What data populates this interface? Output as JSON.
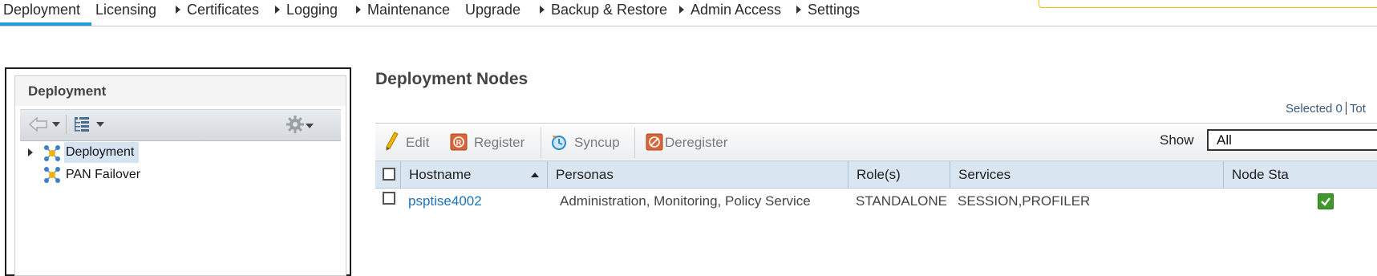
{
  "topnav": {
    "items": [
      {
        "label": "Deployment",
        "has_caret": false,
        "active": true
      },
      {
        "label": "Licensing",
        "has_caret": false,
        "active": false
      },
      {
        "label": "Certificates",
        "has_caret": true,
        "active": false
      },
      {
        "label": "Logging",
        "has_caret": true,
        "active": false
      },
      {
        "label": "Maintenance",
        "has_caret": true,
        "active": false
      },
      {
        "label": "Upgrade",
        "has_caret": false,
        "active": false
      },
      {
        "label": "Backup & Restore",
        "has_caret": true,
        "active": false
      },
      {
        "label": "Admin Access",
        "has_caret": true,
        "active": false
      },
      {
        "label": "Settings",
        "has_caret": true,
        "active": false
      }
    ],
    "accent_color": "#1f9bd7"
  },
  "left_panel": {
    "title": "Deployment",
    "toolbar": {
      "icons": [
        "back-arrow-icon",
        "dropdown-caret-icon",
        "tree-view-icon",
        "dropdown-caret-icon",
        "gear-icon"
      ]
    },
    "tree": [
      {
        "label": "Deployment",
        "icon": "network-nodes-icon",
        "expandable": true,
        "selected": true
      },
      {
        "label": "PAN Failover",
        "icon": "network-nodes-icon",
        "expandable": false,
        "selected": false
      }
    ]
  },
  "main": {
    "title": "Deployment Nodes",
    "selected_text": "Selected 0",
    "total_text": "Tot",
    "actions": [
      {
        "label": "Edit",
        "icon": "pencil-icon"
      },
      {
        "label": "Register",
        "icon": "register-icon"
      },
      {
        "label": "Syncup",
        "icon": "sync-icon"
      },
      {
        "label": "Deregister",
        "icon": "deregister-icon"
      }
    ],
    "show": {
      "label": "Show",
      "value": "All"
    },
    "columns": [
      "Hostname",
      "Personas",
      "Role(s)",
      "Services",
      "Node Sta"
    ],
    "sort": {
      "column": "Hostname",
      "direction": "ascending"
    },
    "rows": [
      {
        "hostname": "psptise4002",
        "personas": "Administration, Monitoring, Policy Service",
        "roles": "STANDALONE",
        "services": "SESSION,PROFILER",
        "node_status": "ok"
      }
    ],
    "status_color": "#3f9a2b"
  }
}
